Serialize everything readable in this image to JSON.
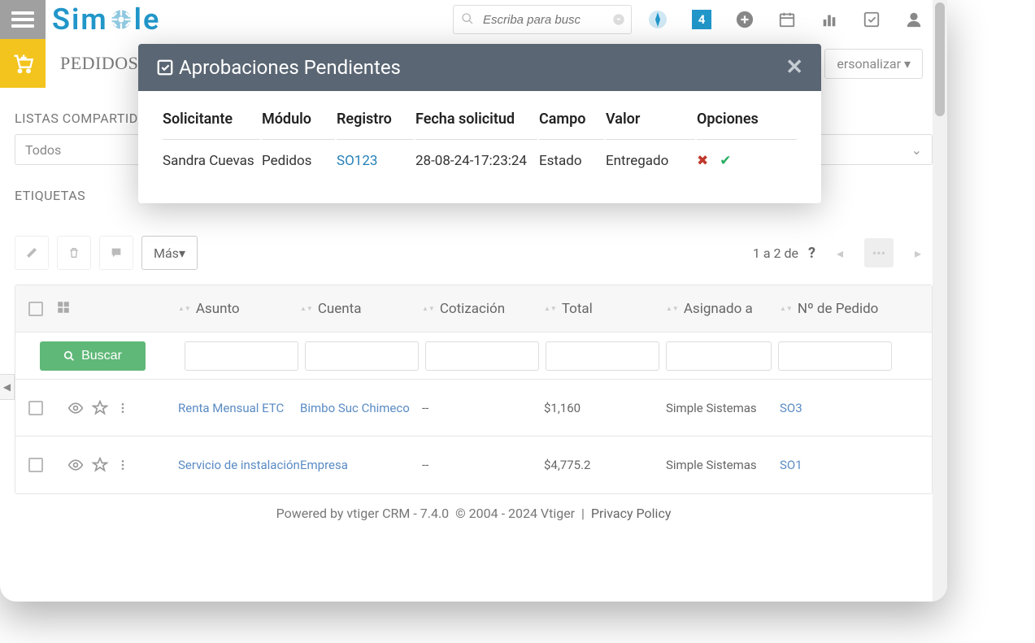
{
  "search_placeholder": "Escriba para busc",
  "badge_count": "4",
  "breadcrumb": {
    "module": "PEDIDOS"
  },
  "personalize_label": "ersonalizar",
  "sidebar": {
    "lists_label": "LISTAS COMPARTID",
    "list_selected": "Todos",
    "tags_label": "ETIQUETAS"
  },
  "toolbar": {
    "more_label": "Más"
  },
  "pagination": {
    "text": "1 a 2  de",
    "question": "?"
  },
  "table": {
    "headers": {
      "asunto": "Asunto",
      "cuenta": "Cuenta",
      "cotizacion": "Cotización",
      "total": "Total",
      "asignado": "Asignado a",
      "pedido": "Nº de Pedido"
    },
    "search_btn": "Buscar",
    "rows": [
      {
        "asunto": "Renta Mensual ETC",
        "cuenta": "Bimbo Suc Chimeco",
        "cotizacion": "--",
        "total": "$1,160",
        "asignado": "Simple Sistemas",
        "pedido": "SO3"
      },
      {
        "asunto": "Servicio de instalación",
        "cuenta": "Empresa",
        "cotizacion": "--",
        "total": "$4,775.2",
        "asignado": "Simple Sistemas",
        "pedido": "SO1"
      }
    ]
  },
  "footer": {
    "powered": "Powered by vtiger CRM - 7.4.0",
    "copyright": "© 2004 - 2024   Vtiger",
    "sep": "|",
    "privacy": "Privacy Policy"
  },
  "modal": {
    "title": "Aprobaciones Pendientes",
    "headers": {
      "solicitante": "Solicitante",
      "modulo": "Módulo",
      "registro": "Registro",
      "fecha": "Fecha solicitud",
      "campo": "Campo",
      "valor": "Valor",
      "opciones": "Opciones"
    },
    "row": {
      "solicitante": "Sandra Cuevas",
      "modulo": "Pedidos",
      "registro": "SO123",
      "fecha": "28-08-24-17:23:24",
      "campo": "Estado",
      "valor": "Entregado"
    }
  }
}
